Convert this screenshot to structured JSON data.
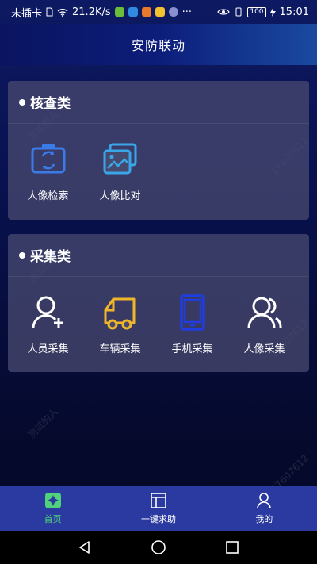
{
  "status_bar": {
    "carrier": "未插卡",
    "speed": "21.2K/s",
    "battery": "100",
    "time": "15:01",
    "more": "···"
  },
  "header": {
    "title": "安防联动"
  },
  "sections": [
    {
      "title": "核查类",
      "items": [
        {
          "label": "人像检索",
          "icon": "face-search-icon",
          "color": "#3b7be8"
        },
        {
          "label": "人像比对",
          "icon": "image-compare-icon",
          "color": "#3aa6e8"
        }
      ]
    },
    {
      "title": "采集类",
      "items": [
        {
          "label": "人员采集",
          "icon": "add-person-icon",
          "color": "#ffffff"
        },
        {
          "label": "车辆采集",
          "icon": "truck-icon",
          "color": "#f0b62a"
        },
        {
          "label": "手机采集",
          "icon": "mobile-phone-icon",
          "color": "#1f3de0"
        },
        {
          "label": "人像采集",
          "icon": "people-icon",
          "color": "#ffffff"
        }
      ]
    }
  ],
  "tab_bar": {
    "tabs": [
      {
        "label": "首页",
        "icon": "home-icon",
        "active": true
      },
      {
        "label": "一键求助",
        "icon": "help-panel-icon",
        "active": false
      },
      {
        "label": "我的",
        "icon": "profile-icon",
        "active": false
      }
    ],
    "active_color": "#4fd27a"
  },
  "watermark": {
    "text": "测试的人",
    "number": "17607612"
  }
}
